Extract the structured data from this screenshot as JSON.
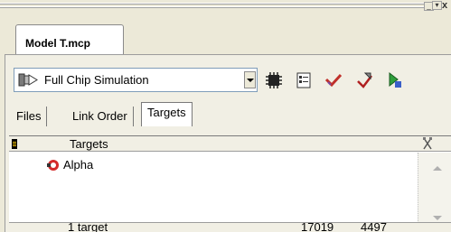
{
  "window": {
    "minimize_glyph": "_",
    "dropdown_glyph": "▾",
    "close_glyph": "x"
  },
  "project_tab": {
    "label": "Model T.mcp"
  },
  "toolbar": {
    "target_value": "Full Chip Simulation",
    "tools": [
      "chip-icon",
      "settings-icon",
      "check-icon",
      "wand-icon",
      "run-icon"
    ]
  },
  "tabs": [
    {
      "label": "Files",
      "active": false
    },
    {
      "label": "Link Order",
      "active": false
    },
    {
      "label": "Targets",
      "active": true
    }
  ],
  "list": {
    "header": {
      "title": "Targets"
    },
    "rows": [
      {
        "label": "Alpha"
      }
    ]
  },
  "footer": {
    "count": "1 target",
    "value1": "17019",
    "value2": "4497"
  }
}
